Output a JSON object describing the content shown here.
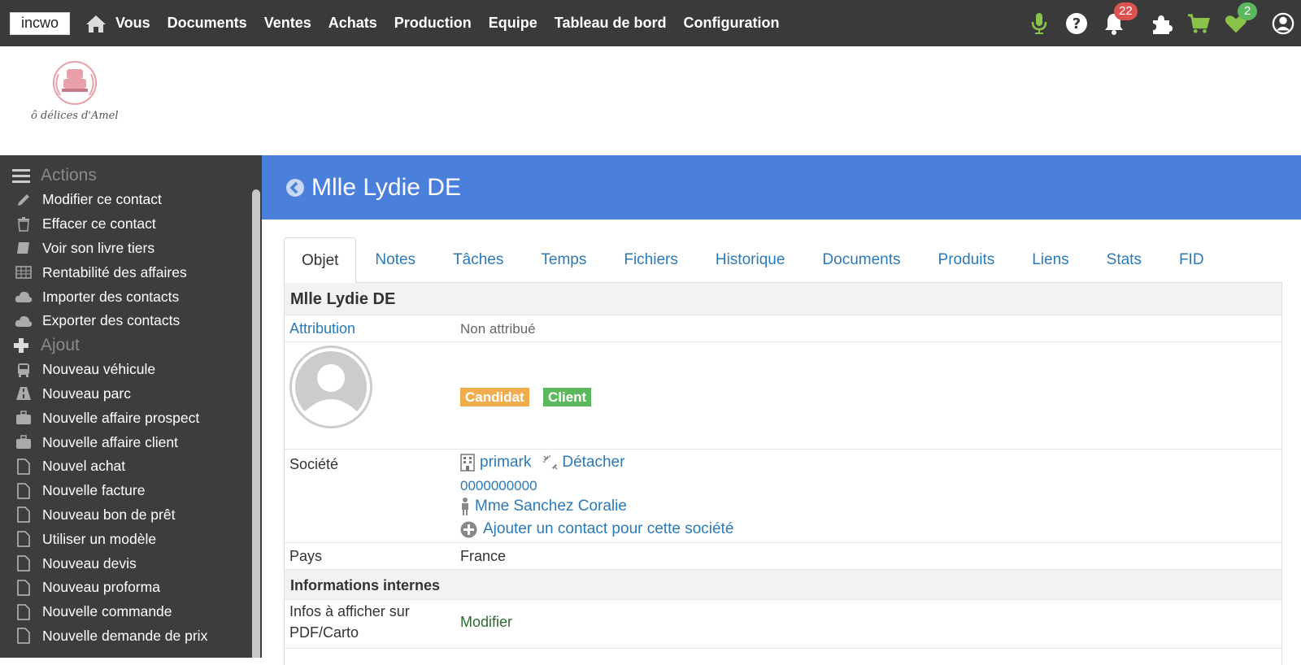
{
  "app": {
    "brand": "incwo"
  },
  "nav": [
    "Vous",
    "Documents",
    "Ventes",
    "Achats",
    "Production",
    "Equipe",
    "Tableau de bord",
    "Configuration"
  ],
  "top_right": {
    "notifications_count": "22",
    "favorites_count": "2"
  },
  "logo": {
    "text": "ô délices d'Amel"
  },
  "sidebar": {
    "actions_title": "Actions",
    "actions": [
      {
        "label": "Modifier ce contact",
        "icon": "pencil-icon"
      },
      {
        "label": "Effacer ce contact",
        "icon": "trash-icon"
      },
      {
        "label": "Voir son livre tiers",
        "icon": "book-icon"
      },
      {
        "label": "Rentabilité des affaires",
        "icon": "table-icon"
      },
      {
        "label": "Importer des contacts",
        "icon": "cloud-upload-icon"
      },
      {
        "label": "Exporter des contacts",
        "icon": "cloud-download-icon"
      }
    ],
    "add_title": "Ajout",
    "add_items": [
      {
        "label": "Nouveau véhicule",
        "icon": "bus-icon"
      },
      {
        "label": "Nouveau parc",
        "icon": "road-icon"
      },
      {
        "label": "Nouvelle affaire prospect",
        "icon": "briefcase-icon"
      },
      {
        "label": "Nouvelle affaire client",
        "icon": "briefcase-icon"
      },
      {
        "label": "Nouvel achat",
        "icon": "file-icon"
      },
      {
        "label": "Nouvelle facture",
        "icon": "file-icon"
      },
      {
        "label": "Nouveau bon de prêt",
        "icon": "file-icon"
      },
      {
        "label": "Utiliser un modèle",
        "icon": "file-icon"
      },
      {
        "label": "Nouveau devis",
        "icon": "file-icon"
      },
      {
        "label": "Nouveau proforma",
        "icon": "file-icon"
      },
      {
        "label": "Nouvelle commande",
        "icon": "file-icon"
      },
      {
        "label": "Nouvelle demande de prix",
        "icon": "file-icon"
      }
    ]
  },
  "header": {
    "title": "Mlle Lydie DE"
  },
  "tabs": [
    "Objet",
    "Notes",
    "Tâches",
    "Temps",
    "Fichiers",
    "Historique",
    "Documents",
    "Produits",
    "Liens",
    "Stats",
    "FID"
  ],
  "contact": {
    "section_title": "Mlle Lydie DE",
    "attribution_label": "Attribution",
    "attribution_value": "Non attribué",
    "tags": [
      "Candidat",
      "Client"
    ],
    "company_label": "Société",
    "company_name": "primark",
    "detach_label": "Détacher",
    "company_phone": "0000000000",
    "company_contact": "Mme Sanchez Coralie",
    "add_contact_label": "Ajouter un contact pour cette société",
    "country_label": "Pays",
    "country_value": "France",
    "internal_section_title": "Informations internes",
    "pdf_info_label_line1": "Infos à afficher sur",
    "pdf_info_label_line2": "PDF/Carto",
    "pdf_info_action": "Modifier"
  },
  "colors": {
    "topbar": "#3a3a3a",
    "sidebar": "#3d3d3d",
    "header": "#4a7fdc",
    "link": "#2a7ab8",
    "tag_orange": "#f0ad4e",
    "tag_green": "#5cb85c",
    "badge_red": "#d9534f"
  }
}
